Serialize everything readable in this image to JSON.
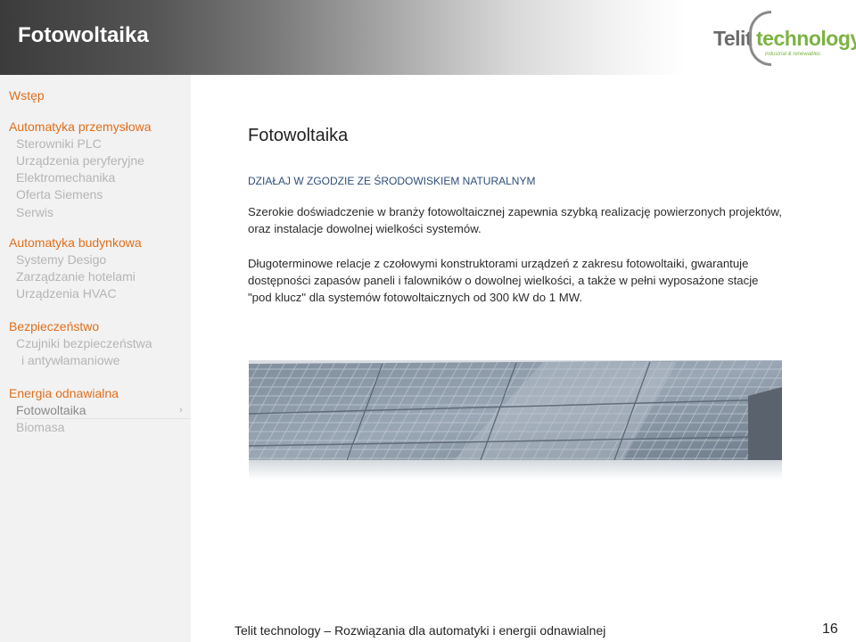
{
  "header": {
    "title": "Fotowoltaika"
  },
  "logo": {
    "telit": "Telit",
    "technology": "technology",
    "tagline": "industrial & renewables"
  },
  "sidebar": {
    "intro": "Wstęp",
    "groups": [
      {
        "title": "Automatyka przemysłowa",
        "items": [
          "Sterowniki PLC",
          "Urządzenia peryferyjne",
          "Elektromechanika",
          "Oferta Siemens",
          "Serwis"
        ]
      },
      {
        "title": "Automatyka budynkowa",
        "items": [
          "Systemy Desigo",
          "Zarządzanie hotelami",
          "Urządzenia HVAC"
        ]
      },
      {
        "title": "Bezpieczeństwo",
        "items": [
          "Czujniki bezpieczeństwa",
          "i antywłamaniowe"
        ]
      },
      {
        "title": "Energia odnawialna",
        "items": [
          "Fotowoltaika",
          "Biomasa"
        ]
      }
    ],
    "arrow": "›"
  },
  "main": {
    "title": "Fotowoltaika",
    "subheader": "DZIAŁAJ W ZGODZIE ZE ŚRODOWISKIEM NATURALNYM",
    "para1": "Szerokie doświadczenie w branży fotowoltaicznej zapewnia szybką realizację powierzonych projektów, oraz instalacje dowolnej wielkości systemów.",
    "para2": "Długoterminowe relacje z czołowymi konstruktorami urządzeń z zakresu fotowoltaiki, gwarantuje dostępności zapasów paneli i falowników o dowolnej wielkości, a także w pełni wyposażone stacje \"pod klucz\" dla systemów fotowoltaicznych od 300 kW do 1 MW."
  },
  "footer": {
    "text": "Telit technology – Rozwiązania dla automatyki i energii odnawialnej",
    "page": "16"
  },
  "colors": {
    "accent": "#e06e1a",
    "subheader": "#2e4f7a",
    "sidebar_bg": "#f2f2f2",
    "logo_green": "#7cb342"
  }
}
